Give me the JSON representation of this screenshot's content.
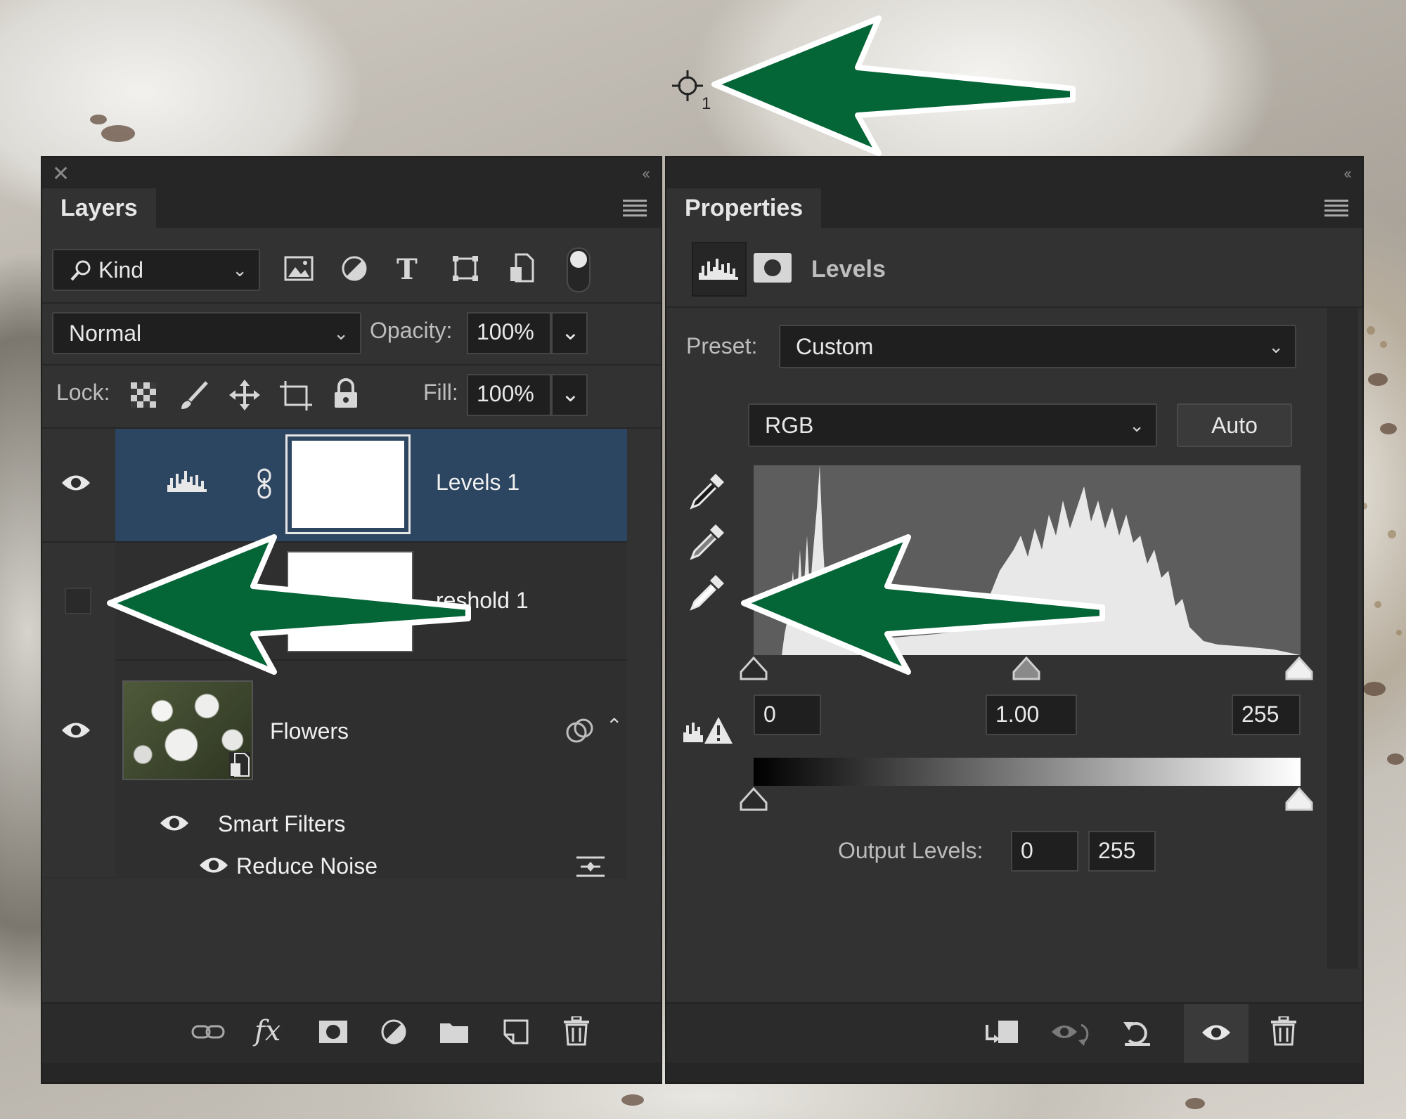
{
  "layers_panel": {
    "title": "Layers",
    "filter_kind": "Kind",
    "blend_mode": "Normal",
    "opacity_label": "Opacity:",
    "opacity_value": "100%",
    "lock_label": "Lock:",
    "fill_label": "Fill:",
    "fill_value": "100%",
    "layers": [
      {
        "name": "Levels 1",
        "visible": true,
        "selected": true
      },
      {
        "name": "Threshold 1",
        "visible": false,
        "selected": false,
        "shown_text": "reshold 1"
      },
      {
        "name": "Flowers",
        "visible": true,
        "selected": false
      }
    ],
    "smart_filters_label": "Smart Filters",
    "reduce_noise_label": "Reduce Noise"
  },
  "properties_panel": {
    "title": "Properties",
    "adjustment_name": "Levels",
    "preset_label": "Preset:",
    "preset_value": "Custom",
    "channel_value": "RGB",
    "auto_button": "Auto",
    "input_black": "0",
    "input_gamma": "1.00",
    "input_white": "255",
    "output_label": "Output Levels:",
    "output_black": "0",
    "output_white": "255"
  },
  "cursor_label": "1",
  "colors": {
    "panel": "#323232",
    "selected_row": "#2c4561",
    "arrow": "#046537"
  }
}
